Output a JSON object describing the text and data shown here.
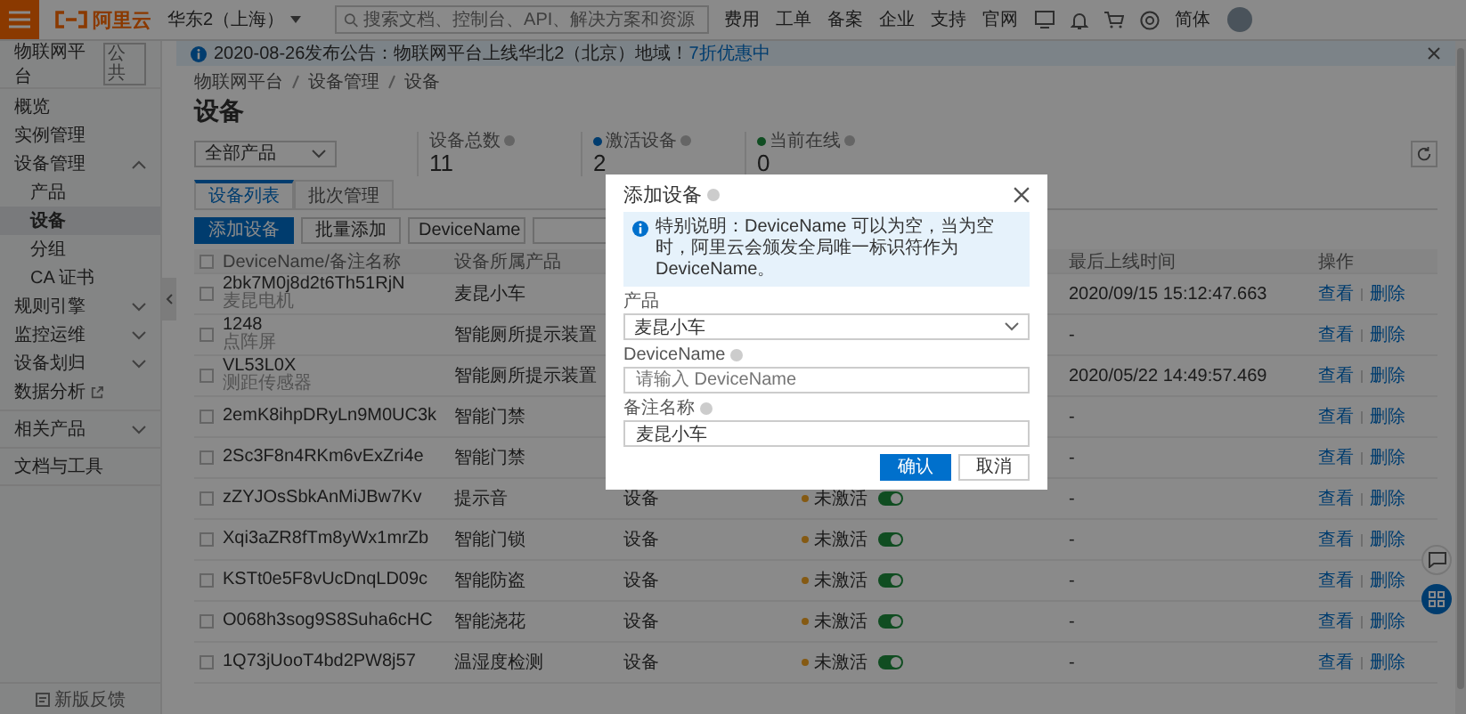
{
  "top_bar": {
    "logo": "阿里云",
    "region": "华东2（上海）",
    "search_placeholder": "搜索文档、控制台、API、解决方案和资源",
    "nav": [
      "费用",
      "工单",
      "备案",
      "企业",
      "支持",
      "官网"
    ],
    "language": "简体"
  },
  "sidebar": {
    "title": "物联网平台",
    "badge": "公共",
    "sections": [
      {
        "items": [
          {
            "label": "概览",
            "selected": false
          },
          {
            "label": "实例管理",
            "selected": false
          },
          {
            "label": "设备管理",
            "selected": false,
            "expanded": true,
            "children": [
              {
                "label": "产品",
                "selected": false
              },
              {
                "label": "设备",
                "selected": true
              },
              {
                "label": "分组",
                "selected": false
              },
              {
                "label": "CA 证书",
                "selected": false
              }
            ]
          },
          {
            "label": "规则引擎",
            "selected": false,
            "expanded": false
          },
          {
            "label": "监控运维",
            "selected": false,
            "expanded": false
          },
          {
            "label": "设备划归",
            "selected": false,
            "expanded": false
          },
          {
            "label": "数据分析",
            "selected": false,
            "external": true
          }
        ]
      },
      {
        "items": [
          {
            "label": "相关产品",
            "selected": false,
            "expanded": false
          }
        ]
      },
      {
        "items": [
          {
            "label": "文档与工具",
            "selected": false
          }
        ]
      }
    ],
    "feedback": "新版反馈"
  },
  "announcement": {
    "text": "2020-08-26发布公告：物联网平台上线华北2（北京）地域！",
    "link": "7折优惠中"
  },
  "breadcrumb": [
    "物联网平台",
    "设备管理",
    "设备"
  ],
  "page_title": "设备",
  "product_filter": "全部产品",
  "stats": [
    {
      "label": "设备总数",
      "value": "11"
    },
    {
      "label": "激活设备",
      "value": "2",
      "color": "#003c6e"
    },
    {
      "label": "当前在线",
      "value": "0",
      "color": "#104d22"
    }
  ],
  "tabs": [
    {
      "label": "设备列表",
      "selected": true
    },
    {
      "label": "批次管理",
      "selected": false
    }
  ],
  "toolbar": {
    "primary": "添加设备",
    "secondary": "批量添加",
    "field_select": "DeviceName"
  },
  "table": {
    "all_checked": false,
    "columns": [
      "DeviceName/备注名称",
      "设备所属产品",
      "",
      "",
      "最后上线时间",
      "操作"
    ],
    "rows": [
      {
        "checked": false,
        "name": "2bk7M0j8d2t6Th51RjN",
        "note": "麦昆电机",
        "product": "麦昆小车",
        "last_online": "2020/09/15 15:12:47.663",
        "actions": [
          "查看",
          "删除"
        ]
      },
      {
        "checked": false,
        "name": "1248",
        "note": "点阵屏",
        "product": "智能厕所提示装置",
        "last_online": "-",
        "actions": [
          "查看",
          "删除"
        ]
      },
      {
        "checked": false,
        "name": "VL53L0X",
        "note": "测距传感器",
        "product": "智能厕所提示装置",
        "last_online": "2020/05/22 14:49:57.469",
        "actions": [
          "查看",
          "删除"
        ]
      },
      {
        "checked": false,
        "name": "2emK8ihpDRyLn9M0UC3k",
        "product": "智能门禁",
        "last_online": "-",
        "actions": [
          "查看",
          "删除"
        ]
      },
      {
        "checked": false,
        "name": "2Sc3F8n4RKm6vExZri4e",
        "product": "智能门禁",
        "last_online": "-",
        "actions": [
          "查看",
          "删除"
        ]
      },
      {
        "checked": false,
        "name": "zZYJOsSbkAnMiJBw7Kv",
        "product": "提示音",
        "node_type": "设备",
        "status": "未激活",
        "enabled": true,
        "last_online": "-",
        "actions": [
          "查看",
          "删除"
        ]
      },
      {
        "checked": false,
        "name": "Xqi3aZR8fTm8yWx1mrZb",
        "product": "智能门锁",
        "node_type": "设备",
        "status": "未激活",
        "enabled": true,
        "last_online": "-",
        "actions": [
          "查看",
          "删除"
        ]
      },
      {
        "checked": false,
        "name": "KSTt0e5F8vUcDnqLD09c",
        "product": "智能防盗",
        "node_type": "设备",
        "status": "未激活",
        "enabled": true,
        "last_online": "-",
        "actions": [
          "查看",
          "删除"
        ]
      },
      {
        "checked": false,
        "name": "O068h3sog9S8Suha6cHC",
        "product": "智能浇花",
        "node_type": "设备",
        "status": "未激活",
        "enabled": true,
        "last_online": "-",
        "actions": [
          "查看",
          "删除"
        ]
      },
      {
        "checked": false,
        "name": "1Q73jUooT4bd2PW8j57",
        "product": "温湿度检测",
        "node_type": "设备",
        "status": "未激活",
        "enabled": true,
        "last_online": "-",
        "actions": [
          "查看",
          "删除"
        ]
      }
    ]
  },
  "dialog": {
    "title": "添加设备",
    "notice": "特别说明：DeviceName 可以为空，当为空时，阿里云会颁发全局唯一标识符作为 DeviceName。",
    "fields": [
      {
        "kind": "select",
        "label": "产品",
        "value": "麦昆小车",
        "help": false
      },
      {
        "kind": "input",
        "label": "DeviceName",
        "placeholder": "请输入 DeviceName",
        "help": true
      },
      {
        "kind": "input",
        "label": "备注名称",
        "value": "麦昆小车",
        "help": true
      }
    ],
    "confirm": "确认",
    "cancel": "取消"
  }
}
